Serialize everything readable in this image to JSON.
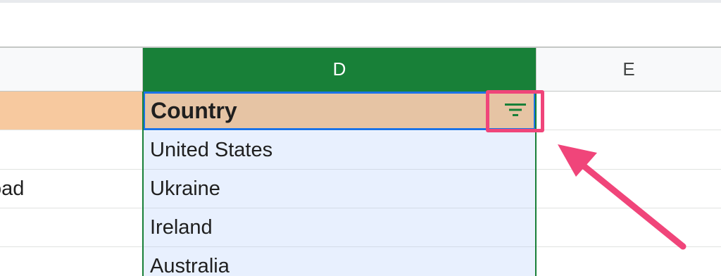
{
  "columns": {
    "c_label": "",
    "d_label": "D",
    "e_label": "E"
  },
  "rows": [
    {
      "c": "",
      "d": "Country",
      "e": ""
    },
    {
      "c": "",
      "d": "United States",
      "e": ""
    },
    {
      "c": "oad",
      "d": "Ukraine",
      "e": ""
    },
    {
      "c": "",
      "d": "Ireland",
      "e": ""
    },
    {
      "c": "",
      "d": "Australia",
      "e": ""
    }
  ],
  "filter_button": {
    "icon": "filter-icon"
  },
  "colors": {
    "selected_column_header": "#188038",
    "header_cell": "#e6c4a4",
    "column_c_header_cell": "#f7c99f",
    "column_selection_fill": "#e8f0fe",
    "annotation_pink": "#f0457a",
    "filter_icon": "#188038"
  }
}
